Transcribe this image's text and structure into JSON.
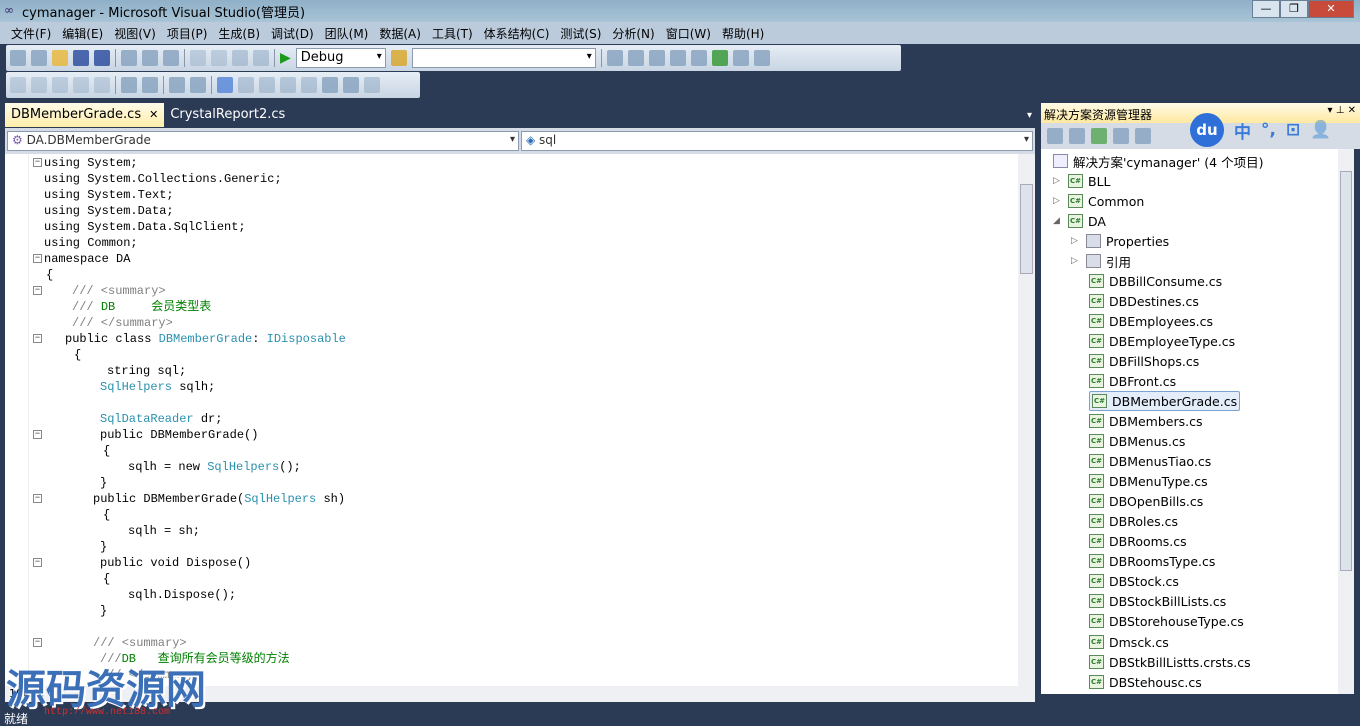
{
  "window": {
    "title": "cymanager - Microsoft Visual Studio(管理员)",
    "controls": [
      "—",
      "❐",
      "✕"
    ]
  },
  "menu": [
    "文件(F)",
    "编辑(E)",
    "视图(V)",
    "项目(P)",
    "生成(B)",
    "调试(D)",
    "团队(M)",
    "数据(A)",
    "工具(T)",
    "体系结构(C)",
    "测试(S)",
    "分析(N)",
    "窗口(W)",
    "帮助(H)"
  ],
  "toolbar": {
    "config": "Debug",
    "platform": ""
  },
  "tabs": [
    {
      "label": "DBMemberGrade.cs",
      "active": true,
      "close": "✕"
    },
    {
      "label": "CrystalReport2.cs",
      "active": false
    }
  ],
  "nav": {
    "type": "DA.DBMemberGrade",
    "member": "sql"
  },
  "code": [
    [
      [
        "using System;",
        "kw"
      ]
    ],
    [
      [
        "using System.Collections.Generic;",
        "kw"
      ]
    ],
    [
      [
        "using System.Text;",
        "kw"
      ]
    ],
    [
      [
        "using System.Data;",
        "kw"
      ]
    ],
    [
      [
        "using System.Data.SqlClient;",
        "kw"
      ]
    ],
    [
      [
        "using Common;",
        "kw"
      ]
    ],
    [
      [
        "namespace DA",
        "kw"
      ]
    ],
    [
      [
        "{",
        "kw"
      ]
    ],
    [
      [
        "/// <summary>",
        "xd"
      ]
    ],
    [
      [
        "/// ",
        "xd"
      ],
      [
        "DB     会员类型表",
        "cm"
      ]
    ],
    [
      [
        "/// </summary>",
        "xd"
      ]
    ],
    [
      [
        "public class ",
        "kw"
      ],
      [
        "DBMemberGrade",
        "ty"
      ],
      [
        ": ",
        "kw"
      ],
      [
        "IDisposable",
        "ty"
      ]
    ],
    [
      [
        "{",
        "kw"
      ]
    ],
    [
      [
        "string sql;",
        "kw"
      ]
    ],
    [
      [
        "SqlHelpers",
        "ty"
      ],
      [
        " sqlh;",
        "kw"
      ]
    ],
    [],
    [
      [
        "SqlDataReader",
        "ty"
      ],
      [
        " dr;",
        "kw"
      ]
    ],
    [
      [
        "public DBMemberGrade()",
        "kw"
      ]
    ],
    [
      [
        "{",
        "kw"
      ]
    ],
    [
      [
        "sqlh = new ",
        "kw"
      ],
      [
        "SqlHelpers",
        "ty"
      ],
      [
        "();",
        "kw"
      ]
    ],
    [
      [
        "}",
        "kw"
      ]
    ],
    [
      [
        "public DBMemberGrade(",
        "kw"
      ],
      [
        "SqlHelpers",
        "ty"
      ],
      [
        " sh)",
        "kw"
      ]
    ],
    [
      [
        "{",
        "kw"
      ]
    ],
    [
      [
        "sqlh = sh;",
        "kw"
      ]
    ],
    [
      [
        "}",
        "kw"
      ]
    ],
    [
      [
        "public void Dispose()",
        "kw"
      ]
    ],
    [
      [
        "{",
        "kw"
      ]
    ],
    [
      [
        "sqlh.Dispose();",
        "kw"
      ]
    ],
    [
      [
        "}",
        "kw"
      ]
    ],
    [],
    [
      [
        "/// <summary>",
        "xd"
      ]
    ],
    [
      [
        "///",
        "xd"
      ],
      [
        "DB   查询所有会员等级的方法",
        "cm"
      ]
    ],
    [
      [
        "/// </summary>",
        "xd"
      ]
    ]
  ],
  "editor": {
    "zoom": "100 %"
  },
  "solution_explorer": {
    "title": "解决方案资源管理器",
    "ime": {
      "logo": "du",
      "items": [
        "中",
        "°,",
        "⊡",
        "👤"
      ]
    },
    "root": "解决方案'cymanager' (4 个项目)",
    "projects": [
      "BLL",
      "Common",
      "DA"
    ],
    "da_folders": [
      "Properties",
      "引用"
    ],
    "files": [
      "DBBillConsume.cs",
      "DBDestines.cs",
      "DBEmployees.cs",
      "DBEmployeeType.cs",
      "DBFillShops.cs",
      "DBFront.cs",
      "DBMemberGrade.cs",
      "DBMembers.cs",
      "DBMenus.cs",
      "DBMenusTiao.cs",
      "DBMenuType.cs",
      "DBOpenBills.cs",
      "DBRoles.cs",
      "DBRooms.cs",
      "DBRoomsType.cs",
      "DBStock.cs",
      "DBStockBillLists.cs",
      "DBStorehouseType.cs",
      "Dmsck.cs",
      "DBStkBillListts.crsts.cs",
      "DBStehousc.cs"
    ],
    "selected": "DBMemberGrade.cs"
  },
  "status": "就绪",
  "watermark": {
    "text": "源码资源网",
    "url": "http://www.net188.com"
  }
}
